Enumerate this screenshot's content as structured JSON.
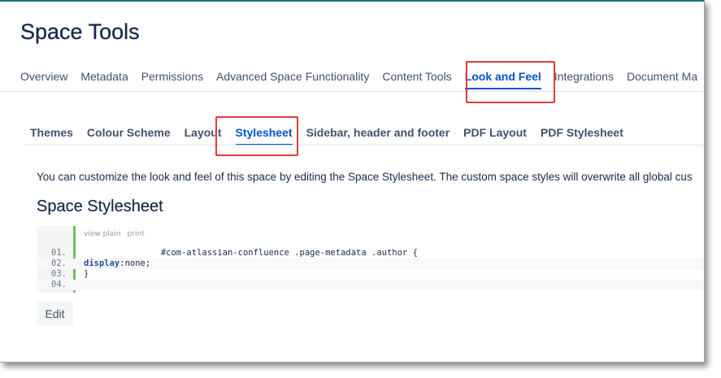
{
  "page": {
    "title": "Space Tools"
  },
  "main_tabs": [
    {
      "label": "Overview",
      "active": false
    },
    {
      "label": "Metadata",
      "active": false
    },
    {
      "label": "Permissions",
      "active": false
    },
    {
      "label": "Advanced Space Functionality",
      "active": false
    },
    {
      "label": "Content Tools",
      "active": false
    },
    {
      "label": "Look and Feel",
      "active": true
    },
    {
      "label": "Integrations",
      "active": false
    },
    {
      "label": "Document Ma",
      "active": false
    }
  ],
  "sub_tabs": [
    {
      "label": "Themes",
      "active": false
    },
    {
      "label": "Colour Scheme",
      "active": false
    },
    {
      "label": "Layout",
      "active": false
    },
    {
      "label": "Stylesheet",
      "active": true
    },
    {
      "label": "Sidebar, header and footer",
      "active": false
    },
    {
      "label": "PDF Layout",
      "active": false
    },
    {
      "label": "PDF Stylesheet",
      "active": false
    }
  ],
  "content": {
    "description": "You can customize the look and feel of this space by editing the Space Stylesheet. The custom space styles will overwrite all global cus",
    "heading": "Space Stylesheet"
  },
  "code_block": {
    "view_plain": "view plain",
    "print": "print",
    "lines": [
      {
        "number": "01.",
        "text": "               #com-atlassian-confluence .page-metadata .author {"
      },
      {
        "number": "02.",
        "keyword": "display",
        "text": ":none;"
      },
      {
        "number": "03.",
        "text": "}"
      },
      {
        "number": "04.",
        "text": ""
      }
    ]
  },
  "actions": {
    "edit_label": "Edit"
  },
  "colors": {
    "accent": "#0052cc",
    "highlight": "#e03b3b",
    "code_gutter_bar": "#6ac259"
  }
}
